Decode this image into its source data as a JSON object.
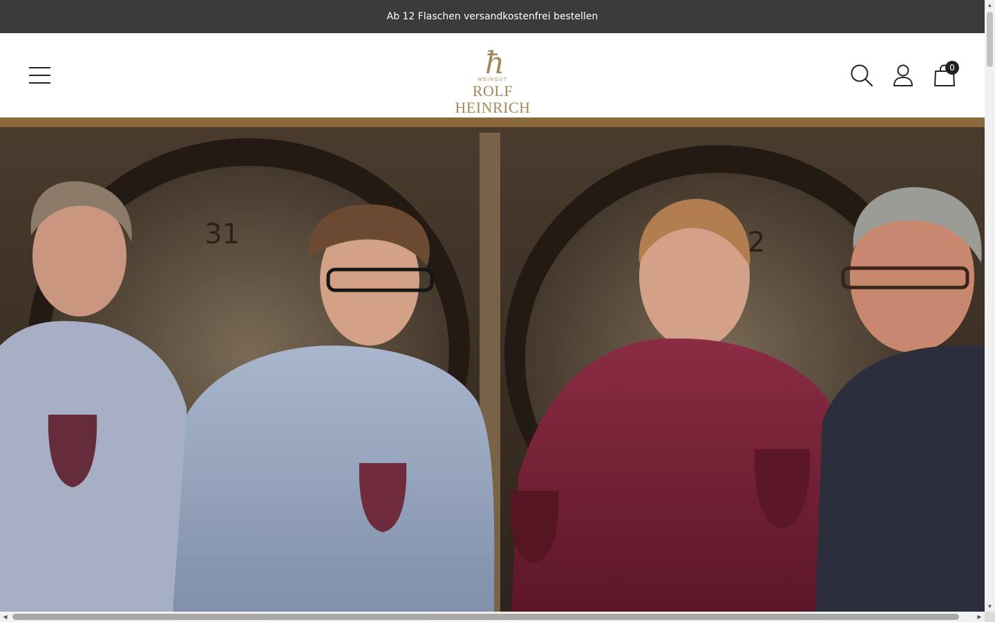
{
  "announcement": {
    "text": "Ab 12 Flaschen versandkostenfrei bestellen"
  },
  "header": {
    "logo": {
      "mark": "ħ",
      "sub": "WEINGUT",
      "name": "ROLF HEINRICH"
    },
    "cart_count": "0"
  },
  "icons": {
    "menu": "hamburger-icon",
    "search": "search-icon",
    "account": "user-icon",
    "cart": "shopping-bag-icon"
  },
  "colors": {
    "announce_bg": "#3b3b3b",
    "brand_gold": "#a08a5b",
    "wine_red": "#7a2035"
  }
}
